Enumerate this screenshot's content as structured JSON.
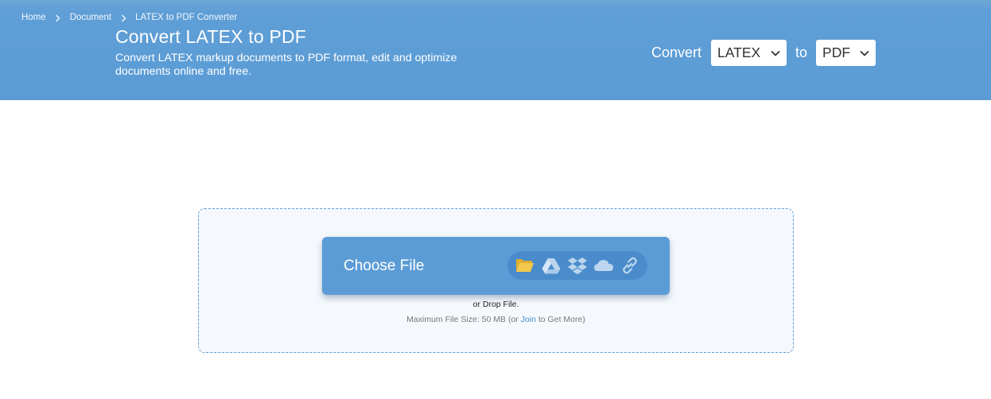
{
  "breadcrumb": {
    "items": [
      "Home",
      "Document",
      "LATEX to PDF Converter"
    ]
  },
  "header": {
    "title": "Convert LATEX to PDF",
    "subtitle": "Convert LATEX markup documents to PDF format, edit and optimize documents online and free."
  },
  "converter": {
    "convert_label": "Convert",
    "from_value": "LATEX",
    "to_label": "to",
    "to_value": "PDF"
  },
  "upload": {
    "choose_label": "Choose File",
    "drop_text": "or Drop File.",
    "limit_prefix": "Maximum File Size: 50 MB (or ",
    "join_label": "Join",
    "limit_suffix": " to Get More)",
    "sources": [
      "folder-icon",
      "google-drive-icon",
      "dropbox-icon",
      "onedrive-icon",
      "link-icon"
    ]
  },
  "colors": {
    "brand_blue": "#5b9cd6",
    "pill_blue": "#4a8ccb",
    "folder_yellow": "#f2c94c",
    "icon_light": "#bcd6ef"
  }
}
